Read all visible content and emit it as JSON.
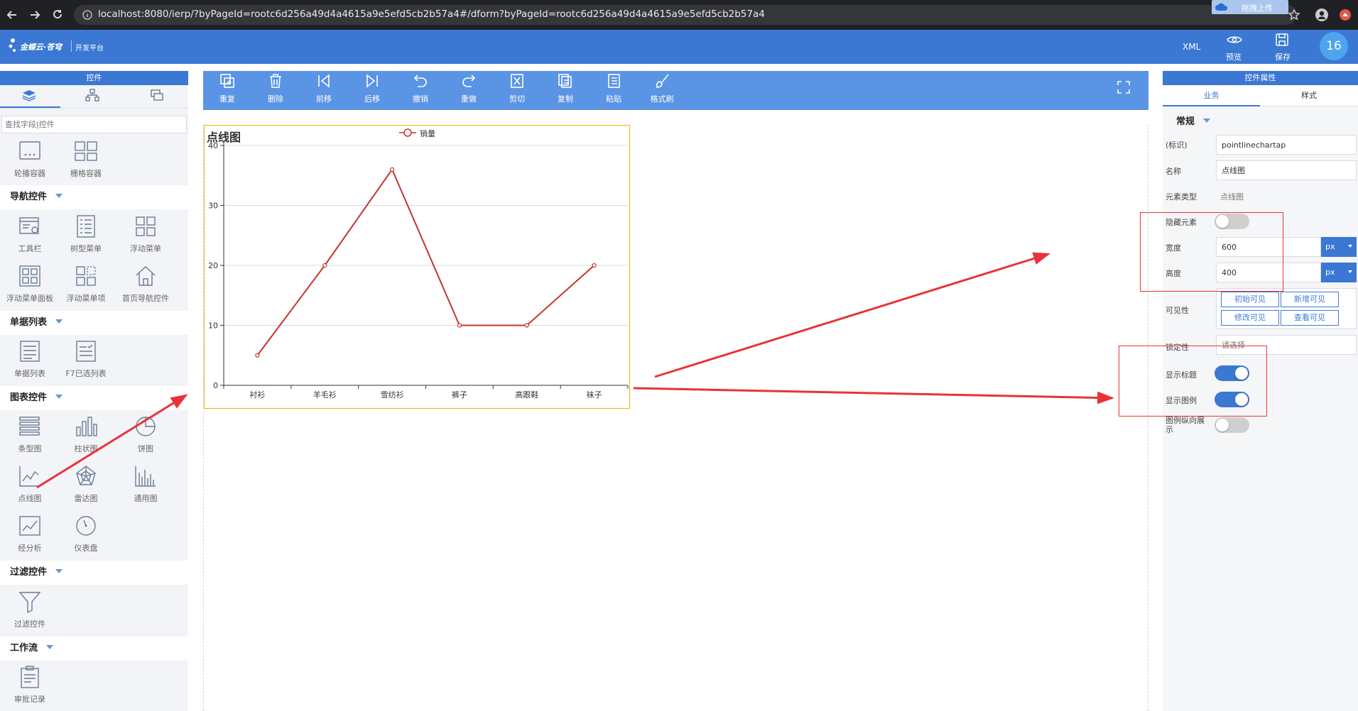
{
  "browser": {
    "url": "localhost:8080/ierp/?byPageId=rootc6d256a49d4a4615a9e5efd5cb2b57a4#/dform?byPageId=rootc6d256a49d4a4615a9e5efd5cb2b57a4",
    "upload_label": "拖拽上传"
  },
  "header": {
    "brand": "金蝶云·苍穹",
    "platform": "开发平台",
    "xml_label": "XML",
    "preview_label": "预览",
    "save_label": "保存",
    "avatar_text": "16",
    "bg_color": "#3a78d4"
  },
  "palette": {
    "title": "控件",
    "search_placeholder": "查找字段|控件",
    "container_items": [
      "轮播容器",
      "栅格容器"
    ],
    "sections": [
      {
        "title": "导航控件",
        "items": [
          "工具栏",
          "树型菜单",
          "浮动菜单",
          "浮动菜单面板",
          "浮动菜单项",
          "首页导航控件"
        ]
      },
      {
        "title": "单据列表",
        "items": [
          "单据列表",
          "F7已选列表"
        ]
      },
      {
        "title": "图表控件",
        "items": [
          "条型图",
          "柱状图",
          "饼图",
          "点线图",
          "雷达图",
          "通用图",
          "经分析",
          "仪表盘"
        ]
      },
      {
        "title": "过滤控件",
        "items": [
          "过滤控件"
        ]
      },
      {
        "title": "工作流",
        "items": [
          "审批记录"
        ]
      }
    ]
  },
  "toolbar": {
    "buttons": [
      "重复",
      "删除",
      "前移",
      "后移",
      "撤销",
      "重做",
      "剪切",
      "复制",
      "粘贴",
      "格式刷"
    ]
  },
  "chart_widget": {
    "title": "点线图",
    "legend": "销量"
  },
  "chart_data": {
    "type": "line",
    "title": "点线图",
    "categories": [
      "衬衫",
      "羊毛衫",
      "雪纺衫",
      "裤子",
      "高跟鞋",
      "袜子"
    ],
    "series": [
      {
        "name": "销量",
        "values": [
          5,
          20,
          36,
          10,
          10,
          20
        ]
      }
    ],
    "yticks": [
      "0",
      "10",
      "20",
      "30",
      "40"
    ],
    "ylim": [
      0,
      40
    ],
    "grid": true,
    "legend_position": "top",
    "color": "#c23531"
  },
  "properties": {
    "title": "控件属性",
    "tabs": [
      "业务",
      "样式"
    ],
    "group": "常规",
    "id_label": "(标识)",
    "id_value": "pointlinechartap",
    "name_label": "名称",
    "name_value": "点线图",
    "type_label": "元素类型",
    "type_value": "点线图",
    "hide_label": "隐藏元素",
    "hide_on": false,
    "width_label": "宽度",
    "width_value": "600",
    "height_label": "高度",
    "height_value": "400",
    "unit": "px",
    "visible_label": "可见性",
    "visible_buttons": [
      "初始可见",
      "新增可见",
      "修改可见",
      "查看可见"
    ],
    "lock_label": "锁定性",
    "lock_placeholder": "请选择",
    "show_title_label": "显示标题",
    "show_title_on": true,
    "show_legend_label": "显示图例",
    "show_legend_on": true,
    "legend_vertical_label": "图例纵向展示",
    "legend_vertical_on": false
  }
}
